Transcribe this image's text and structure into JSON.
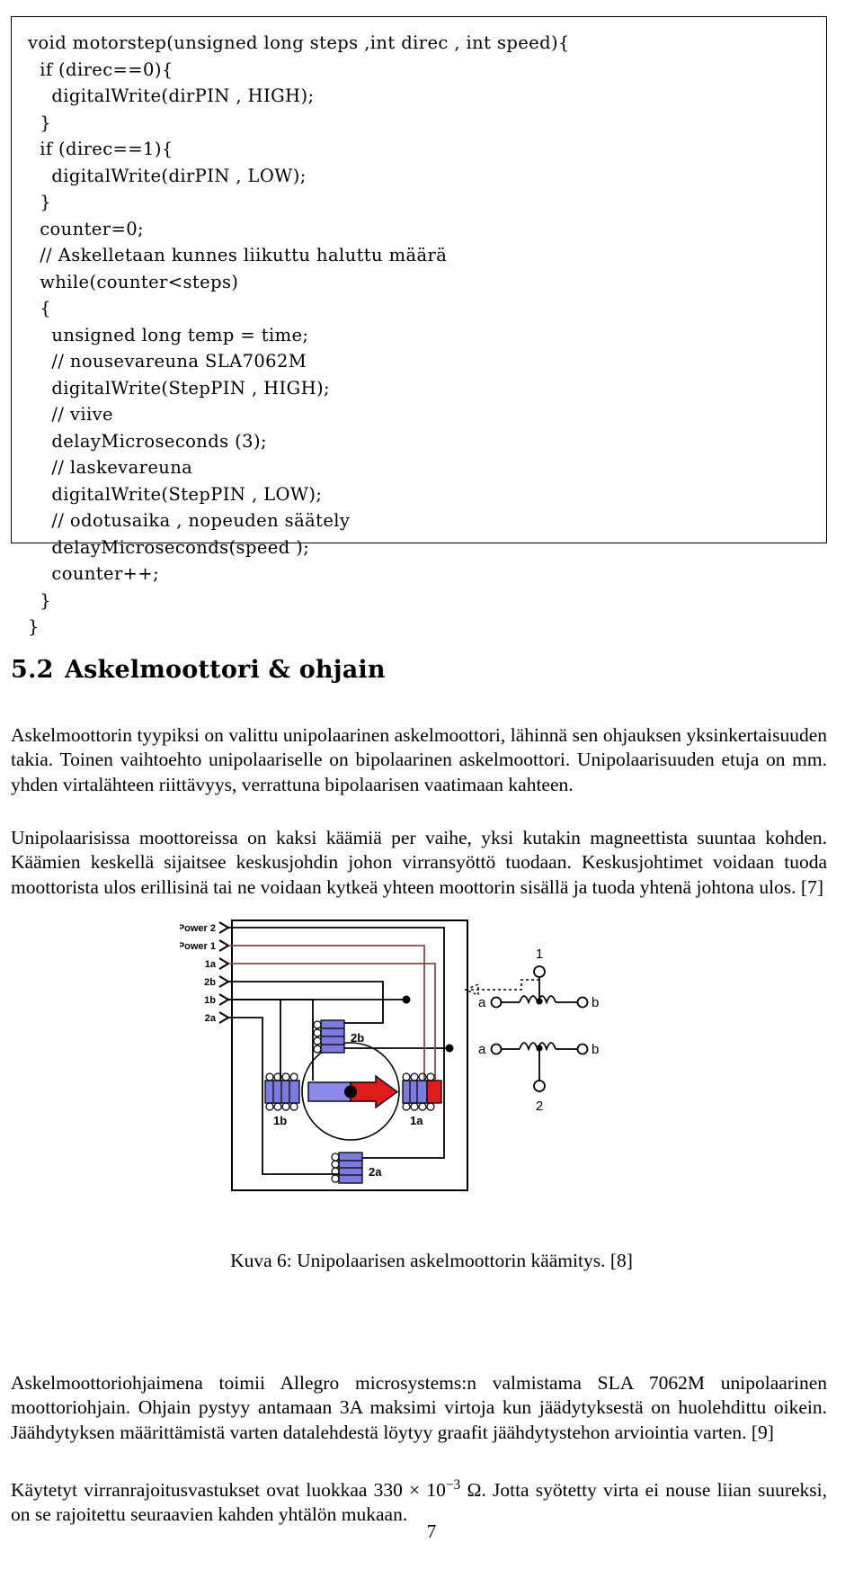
{
  "code_listing": {
    "name": "motorstep-code-listing",
    "lines": [
      "void motorstep(unsigned long steps ,int direc , int speed){",
      "  if (direc==0){",
      "    digitalWrite(dirPIN , HIGH);",
      "  }",
      "  if (direc==1){",
      "    digitalWrite(dirPIN , LOW);",
      "  }",
      "  counter=0;",
      "  // Askelletaan kunnes liikuttu haluttu määrä",
      "  while(counter<steps)",
      "  {",
      "    unsigned long temp = time;",
      "    // nousevareuna SLA7062M",
      "    digitalWrite(StepPIN , HIGH);",
      "    // viive",
      "    delayMicroseconds (3);",
      "    // laskevareuna",
      "    digitalWrite(StepPIN , LOW);",
      "    // odotusaika , nopeuden säätely",
      "    delayMicroseconds(speed );",
      "    counter++;",
      "  }",
      "}"
    ]
  },
  "section": {
    "number": "5.2",
    "title": "Askelmoottori & ohjain"
  },
  "paragraphs": {
    "p1": "Askelmoottorin tyypiksi on valittu unipolaarinen askelmoottori, lähinnä sen ohjauksen yksinkertaisuuden takia. Toinen vaihtoehto unipolaariselle on bipolaarinen askelmoottori. Unipolaarisuuden etuja on mm. yhden virtalähteen riittävyys, verrattuna bipolaarisen vaatimaan kahteen.",
    "p2": "Unipolaarisissa moottoreissa on kaksi käämiä per vaihe, yksi kutakin magneettista suuntaa kohden. Käämien keskellä sijaitsee keskusjohdin johon virransyöttö tuodaan. Keskusjohtimet voidaan tuoda moottorista ulos erillisinä tai ne voidaan kytkeä yhteen moottorin sisällä ja tuoda yhtenä johtona ulos. [7]",
    "p3": "Askelmoottoriohjaimena toimii Allegro microsystems:n valmistama SLA 7062M unipolaarinen moottoriohjain. Ohjain pystyy antamaan 3A maksimi virtoja kun jäädytyksestä on huolehdittu oikein. Jäähdytyksen määrittämistä varten datalehdestä löytyy graafit jäähdytystehon arviointia varten. [9]",
    "p4_part1": "Käytetyt virranrajoitusvastukset ovat luokkaa 330 × 10",
    "p4_sup": "−3",
    "p4_part2": " Ω. Jotta syötetty virta ei nouse liian suureksi, on se rajoitettu seuraavien kahden yhtälön mukaan."
  },
  "figure": {
    "caption": "Kuva 6: Unipolaarisen askelmoottorin käämitys. [8]",
    "terminal_labels": [
      "Power 2",
      "Power 1",
      "1a",
      "2b",
      "1b",
      "2a"
    ],
    "coil_labels": {
      "top": "2b",
      "left": "1b",
      "right": "1a",
      "bottom": "2a"
    },
    "schematic_labels": {
      "top_node": "1",
      "bottom_node": "2",
      "upper_left": "a",
      "upper_right": "b",
      "lower_left": "a",
      "lower_right": "b"
    },
    "colors": {
      "coil_blue": "#7b7bdd",
      "rotor_blue": "#8a8ae8",
      "rotor_red": "#e01b1b",
      "power_wire": "#8c4a4a",
      "wire": "#000000",
      "outline": "#000000"
    }
  },
  "page_number": "7"
}
